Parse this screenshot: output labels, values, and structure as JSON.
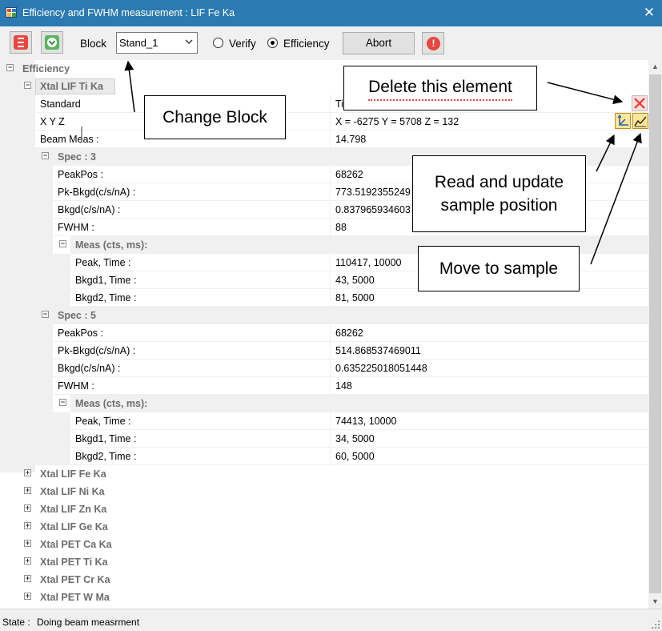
{
  "window": {
    "title": "Efficiency and FWHM measurement : LIF Fe Ka",
    "close_glyph": "✕"
  },
  "toolbar": {
    "block_label": "Block",
    "block_value": "Stand_1",
    "radio_verify": "Verify",
    "radio_efficiency": "Efficiency",
    "selected_mode": "Efficiency",
    "abort_label": "Abort",
    "stop_glyph": "!"
  },
  "tree": {
    "root": "Efficiency",
    "xtal_expanded": {
      "label": "Xtal LIF Ti Ka",
      "properties": [
        {
          "name": "Standard",
          "value": "Ti"
        },
        {
          "name": "X Y Z",
          "value": " X = -6275 Y = 5708 Z = 132"
        },
        {
          "name": "Beam Meas :",
          "value": "14.798"
        }
      ],
      "specs": [
        {
          "label": "Spec : 3",
          "properties": [
            {
              "name": "PeakPos :",
              "value": "68262"
            },
            {
              "name": "Pk-Bkgd(c/s/nA) :",
              "value": "773.5192355249"
            },
            {
              "name": "Bkgd(c/s/nA) :",
              "value": "0.837965934603"
            },
            {
              "name": "FWHM :",
              "value": "88"
            }
          ],
          "meas_label": "Meas (cts, ms):",
          "meas": [
            {
              "name": "Peak, Time :",
              "value": "110417, 10000"
            },
            {
              "name": "Bkgd1, Time :",
              "value": "43, 5000"
            },
            {
              "name": "Bkgd2, Time :",
              "value": "81, 5000"
            }
          ]
        },
        {
          "label": "Spec : 5",
          "properties": [
            {
              "name": "PeakPos :",
              "value": "68262"
            },
            {
              "name": "Pk-Bkgd(c/s/nA) :",
              "value": "514.868537469011"
            },
            {
              "name": "Bkgd(c/s/nA) :",
              "value": "0.635225018051448"
            },
            {
              "name": "FWHM :",
              "value": "148"
            }
          ],
          "meas_label": "Meas (cts, ms):",
          "meas": [
            {
              "name": "Peak, Time :",
              "value": "74413, 10000"
            },
            {
              "name": "Bkgd1, Time :",
              "value": "34, 5000"
            },
            {
              "name": "Bkgd2, Time :",
              "value": "60, 5000"
            }
          ]
        }
      ]
    },
    "collapsed_xtals": [
      "Xtal LIF Fe Ka",
      "Xtal LIF Ni Ka",
      "Xtal LIF Zn Ka",
      "Xtal LIF Ge Ka",
      "Xtal PET Ca Ka",
      "Xtal PET Ti Ka",
      "Xtal PET Cr Ka",
      "Xtal PET W Ma"
    ]
  },
  "annotations": {
    "delete": "Delete this element",
    "change_block": "Change Block",
    "read_update": "Read and update\nsample position",
    "move": "Move to sample"
  },
  "status": {
    "label": "State :",
    "value": "Doing beam measrment"
  },
  "colors": {
    "titlebar": "#2b7ab2",
    "header_text": "#6d6d6d",
    "delete_red": "#e8473f",
    "icon_yellow": "#ffe79a"
  },
  "icons": {
    "app": "app-icon",
    "stop_red": "stop-square-icon",
    "run_green": "down-arrow-icon",
    "warning": "exclamation-icon",
    "delete": "delete-x-icon",
    "read_position": "axes-icon",
    "move_sample": "chart-move-icon"
  }
}
